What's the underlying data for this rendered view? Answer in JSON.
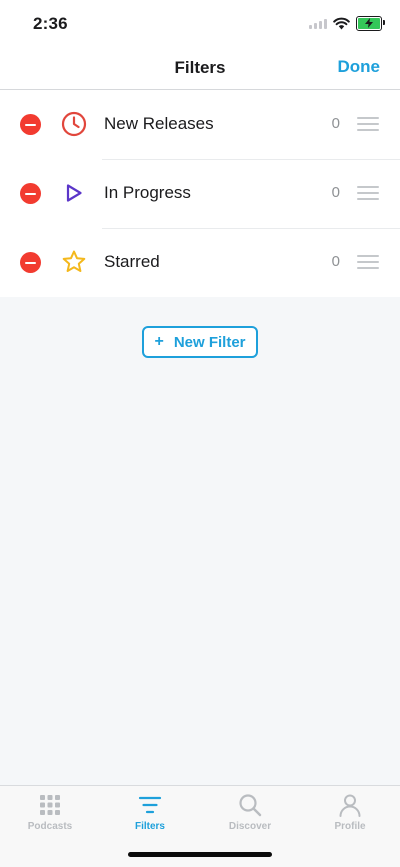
{
  "status_bar": {
    "time": "2:36",
    "battery_color": "#34c759"
  },
  "nav": {
    "title": "Filters",
    "done_label": "Done"
  },
  "filters": [
    {
      "name": "New Releases",
      "count": "0",
      "icon": "clock-icon",
      "color": "#e1463c"
    },
    {
      "name": "In Progress",
      "count": "0",
      "icon": "play-icon",
      "color": "#5b36c9"
    },
    {
      "name": "Starred",
      "count": "0",
      "icon": "star-icon",
      "color": "#f4b81c"
    }
  ],
  "new_filter": {
    "plus": "+",
    "label": "New Filter"
  },
  "tabs": [
    {
      "label": "Podcasts",
      "icon": "grid-icon",
      "active": false
    },
    {
      "label": "Filters",
      "icon": "filter-lines-icon",
      "active": true
    },
    {
      "label": "Discover",
      "icon": "search-icon",
      "active": false
    },
    {
      "label": "Profile",
      "icon": "person-icon",
      "active": false
    }
  ],
  "colors": {
    "accent": "#1ea0db",
    "delete": "#f23b30",
    "inactive_tab": "#b9bcc0"
  }
}
